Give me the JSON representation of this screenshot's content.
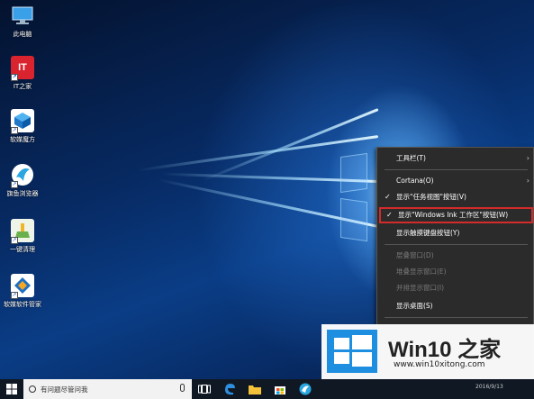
{
  "desktop": {
    "icons": [
      {
        "label": "此电脑",
        "icon": "computer-icon",
        "color": "#3aa0e8"
      },
      {
        "label": "IT之家",
        "icon": "ithome-icon",
        "color": "#d9232e",
        "text": "IT"
      },
      {
        "label": "软媒魔方",
        "icon": "cube-icon",
        "color": "#1f78c8"
      },
      {
        "label": "旗鱼浏览器",
        "icon": "browser-icon",
        "color": "#2aa6e0"
      },
      {
        "label": "一键清理",
        "icon": "cleanup-icon",
        "color": "#6ab04c"
      },
      {
        "label": "软媒软件管家",
        "icon": "software-manager-icon",
        "color": "#1d6fc4"
      }
    ]
  },
  "context_menu": {
    "items": [
      {
        "label": "工具栏(T)",
        "has_submenu": true,
        "checked": false,
        "disabled": false
      },
      {
        "label": "Cortana(O)",
        "has_submenu": true,
        "checked": false,
        "disabled": false
      },
      {
        "label": "显示\"任务视图\"按钮(V)",
        "has_submenu": false,
        "checked": true,
        "disabled": false
      },
      {
        "label": "显示\"Windows Ink 工作区\"按钮(W)",
        "has_submenu": false,
        "checked": true,
        "disabled": false,
        "highlighted": true
      },
      {
        "label": "显示触摸键盘按钮(Y)",
        "has_submenu": false,
        "checked": false,
        "disabled": false
      },
      {
        "label": "层叠窗口(D)",
        "has_submenu": false,
        "checked": false,
        "disabled": true
      },
      {
        "label": "堆叠显示窗口(E)",
        "has_submenu": false,
        "checked": false,
        "disabled": true
      },
      {
        "label": "并排显示窗口(I)",
        "has_submenu": false,
        "checked": false,
        "disabled": true
      },
      {
        "label": "显示桌面(S)",
        "has_submenu": false,
        "checked": false,
        "disabled": false
      }
    ]
  },
  "taskbar": {
    "search_placeholder": "有问题尽管问我",
    "clock_date": "2016/9/13"
  },
  "watermark": {
    "title": "Win10 之家",
    "url": "www.win10xitong.com"
  },
  "colors": {
    "highlight_border": "#d42a2a",
    "menu_bg": "#2b2b2b",
    "taskbar_bg": "#101824",
    "windows_blue": "#1e8fe0"
  }
}
